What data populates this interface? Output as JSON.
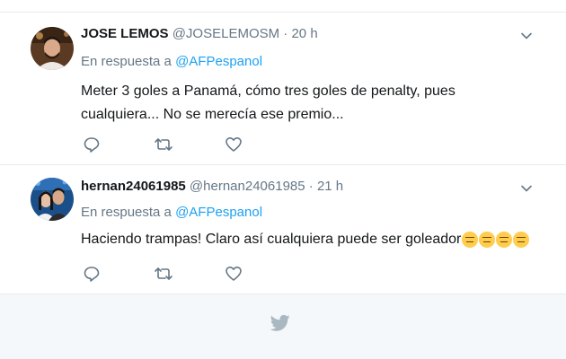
{
  "tweets": [
    {
      "name": "JOSE LEMOS",
      "handle": "@JOSELEMOSM",
      "separator": "·",
      "time": "20 h",
      "reply_prefix": "En respuesta a",
      "reply_to": "@AFPespanol",
      "text": "Meter 3 goles a Panamá, cómo tres goles de penalty, pues cualquiera... No se merecía ese premio...",
      "avatar_icon": "user-avatar-photo",
      "icons": [
        "chevron-down-icon",
        "reply-icon",
        "retweet-icon",
        "heart-icon"
      ]
    },
    {
      "name": "hernan24061985",
      "handle": "@hernan24061985",
      "separator": "·",
      "time": "21 h",
      "reply_prefix": "En respuesta a",
      "reply_to": "@AFPespanol",
      "text": "Haciendo trampas! Claro así cualquiera puede ser goleador",
      "emoji_count": 4,
      "emoji_icon": "expressionless-face-emoji",
      "avatar_icon": "user-avatar-photo",
      "icons": [
        "chevron-down-icon",
        "reply-icon",
        "retweet-icon",
        "heart-icon"
      ]
    }
  ],
  "footer": {
    "icon": "twitter-bird-icon"
  },
  "colors": {
    "link": "#1da1f2",
    "muted": "#657786",
    "text": "#14171a",
    "divider": "#e6ecf0",
    "footer_bg": "#f5f8fa",
    "bird": "#aab8c2"
  }
}
